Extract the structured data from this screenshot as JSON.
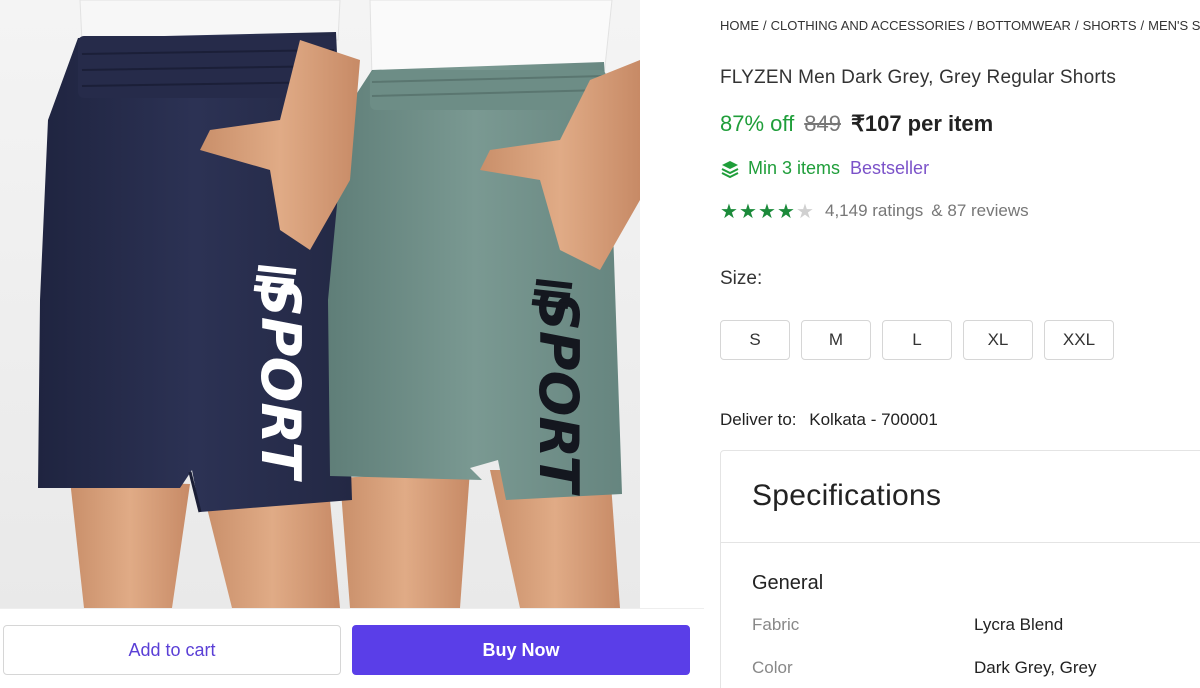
{
  "breadcrumb": [
    "HOME",
    "CLOTHING AND ACCESSORIES",
    "BOTTOMWEAR",
    "SHORTS",
    "MEN'S SHORTS"
  ],
  "product": {
    "title": "FLYZEN Men Dark Grey, Grey Regular Shorts",
    "discount": "87% off",
    "mrp": "849",
    "price": "₹107",
    "per_unit": "per item",
    "min_items": "Min 3 items",
    "badge": "Bestseller",
    "rating_stars": 4,
    "ratings": "4,149 ratings",
    "reviews": "& 87 reviews",
    "image_print_text": "SPORT"
  },
  "size": {
    "label": "Size:",
    "options": [
      "S",
      "M",
      "L",
      "XL",
      "XXL"
    ]
  },
  "delivery": {
    "label": "Deliver to:",
    "location": "Kolkata - 700001"
  },
  "specifications": {
    "title": "Specifications",
    "group": "General",
    "rows": [
      {
        "key": "Fabric",
        "value": "Lycra Blend"
      },
      {
        "key": "Color",
        "value": "Dark Grey, Grey"
      }
    ]
  },
  "actions": {
    "add_to_cart": "Add to cart",
    "buy_now": "Buy Now"
  },
  "colors": {
    "accent": "#5a3ee8",
    "discount_green": "#1f9e3a",
    "bestseller_purple": "#7b52c9",
    "navy_shorts": "#2a2f4f",
    "grey_shorts": "#6f8f88"
  }
}
